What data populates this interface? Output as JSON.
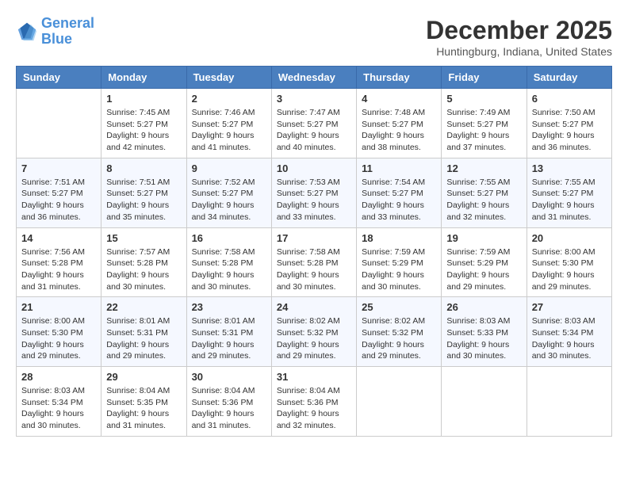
{
  "header": {
    "logo_line1": "General",
    "logo_line2": "Blue",
    "month_title": "December 2025",
    "location": "Huntingburg, Indiana, United States"
  },
  "days_of_week": [
    "Sunday",
    "Monday",
    "Tuesday",
    "Wednesday",
    "Thursday",
    "Friday",
    "Saturday"
  ],
  "weeks": [
    [
      {
        "num": "",
        "sunrise": "",
        "sunset": "",
        "daylight": ""
      },
      {
        "num": "1",
        "sunrise": "Sunrise: 7:45 AM",
        "sunset": "Sunset: 5:27 PM",
        "daylight": "Daylight: 9 hours and 42 minutes."
      },
      {
        "num": "2",
        "sunrise": "Sunrise: 7:46 AM",
        "sunset": "Sunset: 5:27 PM",
        "daylight": "Daylight: 9 hours and 41 minutes."
      },
      {
        "num": "3",
        "sunrise": "Sunrise: 7:47 AM",
        "sunset": "Sunset: 5:27 PM",
        "daylight": "Daylight: 9 hours and 40 minutes."
      },
      {
        "num": "4",
        "sunrise": "Sunrise: 7:48 AM",
        "sunset": "Sunset: 5:27 PM",
        "daylight": "Daylight: 9 hours and 38 minutes."
      },
      {
        "num": "5",
        "sunrise": "Sunrise: 7:49 AM",
        "sunset": "Sunset: 5:27 PM",
        "daylight": "Daylight: 9 hours and 37 minutes."
      },
      {
        "num": "6",
        "sunrise": "Sunrise: 7:50 AM",
        "sunset": "Sunset: 5:27 PM",
        "daylight": "Daylight: 9 hours and 36 minutes."
      }
    ],
    [
      {
        "num": "7",
        "sunrise": "Sunrise: 7:51 AM",
        "sunset": "Sunset: 5:27 PM",
        "daylight": "Daylight: 9 hours and 36 minutes."
      },
      {
        "num": "8",
        "sunrise": "Sunrise: 7:51 AM",
        "sunset": "Sunset: 5:27 PM",
        "daylight": "Daylight: 9 hours and 35 minutes."
      },
      {
        "num": "9",
        "sunrise": "Sunrise: 7:52 AM",
        "sunset": "Sunset: 5:27 PM",
        "daylight": "Daylight: 9 hours and 34 minutes."
      },
      {
        "num": "10",
        "sunrise": "Sunrise: 7:53 AM",
        "sunset": "Sunset: 5:27 PM",
        "daylight": "Daylight: 9 hours and 33 minutes."
      },
      {
        "num": "11",
        "sunrise": "Sunrise: 7:54 AM",
        "sunset": "Sunset: 5:27 PM",
        "daylight": "Daylight: 9 hours and 33 minutes."
      },
      {
        "num": "12",
        "sunrise": "Sunrise: 7:55 AM",
        "sunset": "Sunset: 5:27 PM",
        "daylight": "Daylight: 9 hours and 32 minutes."
      },
      {
        "num": "13",
        "sunrise": "Sunrise: 7:55 AM",
        "sunset": "Sunset: 5:27 PM",
        "daylight": "Daylight: 9 hours and 31 minutes."
      }
    ],
    [
      {
        "num": "14",
        "sunrise": "Sunrise: 7:56 AM",
        "sunset": "Sunset: 5:28 PM",
        "daylight": "Daylight: 9 hours and 31 minutes."
      },
      {
        "num": "15",
        "sunrise": "Sunrise: 7:57 AM",
        "sunset": "Sunset: 5:28 PM",
        "daylight": "Daylight: 9 hours and 30 minutes."
      },
      {
        "num": "16",
        "sunrise": "Sunrise: 7:58 AM",
        "sunset": "Sunset: 5:28 PM",
        "daylight": "Daylight: 9 hours and 30 minutes."
      },
      {
        "num": "17",
        "sunrise": "Sunrise: 7:58 AM",
        "sunset": "Sunset: 5:28 PM",
        "daylight": "Daylight: 9 hours and 30 minutes."
      },
      {
        "num": "18",
        "sunrise": "Sunrise: 7:59 AM",
        "sunset": "Sunset: 5:29 PM",
        "daylight": "Daylight: 9 hours and 30 minutes."
      },
      {
        "num": "19",
        "sunrise": "Sunrise: 7:59 AM",
        "sunset": "Sunset: 5:29 PM",
        "daylight": "Daylight: 9 hours and 29 minutes."
      },
      {
        "num": "20",
        "sunrise": "Sunrise: 8:00 AM",
        "sunset": "Sunset: 5:30 PM",
        "daylight": "Daylight: 9 hours and 29 minutes."
      }
    ],
    [
      {
        "num": "21",
        "sunrise": "Sunrise: 8:00 AM",
        "sunset": "Sunset: 5:30 PM",
        "daylight": "Daylight: 9 hours and 29 minutes."
      },
      {
        "num": "22",
        "sunrise": "Sunrise: 8:01 AM",
        "sunset": "Sunset: 5:31 PM",
        "daylight": "Daylight: 9 hours and 29 minutes."
      },
      {
        "num": "23",
        "sunrise": "Sunrise: 8:01 AM",
        "sunset": "Sunset: 5:31 PM",
        "daylight": "Daylight: 9 hours and 29 minutes."
      },
      {
        "num": "24",
        "sunrise": "Sunrise: 8:02 AM",
        "sunset": "Sunset: 5:32 PM",
        "daylight": "Daylight: 9 hours and 29 minutes."
      },
      {
        "num": "25",
        "sunrise": "Sunrise: 8:02 AM",
        "sunset": "Sunset: 5:32 PM",
        "daylight": "Daylight: 9 hours and 29 minutes."
      },
      {
        "num": "26",
        "sunrise": "Sunrise: 8:03 AM",
        "sunset": "Sunset: 5:33 PM",
        "daylight": "Daylight: 9 hours and 30 minutes."
      },
      {
        "num": "27",
        "sunrise": "Sunrise: 8:03 AM",
        "sunset": "Sunset: 5:34 PM",
        "daylight": "Daylight: 9 hours and 30 minutes."
      }
    ],
    [
      {
        "num": "28",
        "sunrise": "Sunrise: 8:03 AM",
        "sunset": "Sunset: 5:34 PM",
        "daylight": "Daylight: 9 hours and 30 minutes."
      },
      {
        "num": "29",
        "sunrise": "Sunrise: 8:04 AM",
        "sunset": "Sunset: 5:35 PM",
        "daylight": "Daylight: 9 hours and 31 minutes."
      },
      {
        "num": "30",
        "sunrise": "Sunrise: 8:04 AM",
        "sunset": "Sunset: 5:36 PM",
        "daylight": "Daylight: 9 hours and 31 minutes."
      },
      {
        "num": "31",
        "sunrise": "Sunrise: 8:04 AM",
        "sunset": "Sunset: 5:36 PM",
        "daylight": "Daylight: 9 hours and 32 minutes."
      },
      {
        "num": "",
        "sunrise": "",
        "sunset": "",
        "daylight": ""
      },
      {
        "num": "",
        "sunrise": "",
        "sunset": "",
        "daylight": ""
      },
      {
        "num": "",
        "sunrise": "",
        "sunset": "",
        "daylight": ""
      }
    ]
  ]
}
